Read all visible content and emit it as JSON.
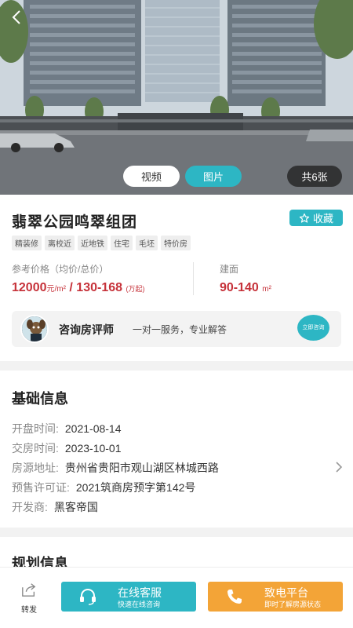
{
  "hero": {
    "tabs": [
      {
        "label": "视频",
        "active": false
      },
      {
        "label": "图片",
        "active": true
      }
    ],
    "photo_count": "共6张"
  },
  "project": {
    "title": "翡翠公园鸣翠组团",
    "favorite_label": "收藏",
    "tags": [
      "精装修",
      "离校近",
      "近地铁",
      "住宅",
      "毛坯",
      "特价房"
    ],
    "price_label": "参考价格（均价/总价）",
    "avg_price": "12000",
    "avg_price_unit": "元/m²",
    "price_sep": " / ",
    "total_price": "130-168",
    "total_price_unit": "(万起)",
    "area_label": "建面",
    "area_value": "90-140",
    "area_unit": "m²"
  },
  "consult": {
    "name": "咨询房评师",
    "desc": "一对一服务，专业解答",
    "button": "立即咨询"
  },
  "basic_info": {
    "title": "基础信息",
    "rows": [
      {
        "label": "开盘时间:",
        "value": "2021-08-14"
      },
      {
        "label": "交房时间:",
        "value": "2023-10-01"
      },
      {
        "label": "房源地址:",
        "value": "贵州省贵阳市观山湖区林城西路"
      },
      {
        "label": "预售许可证:",
        "value": "2021筑商房预字第142号"
      },
      {
        "label": "开发商:",
        "value": "黑客帝国"
      }
    ]
  },
  "planning": {
    "title": "规划信息"
  },
  "bottom_bar": {
    "share_label": "转发",
    "service_main": "在线客服",
    "service_sub": "快速在线咨询",
    "call_main": "致电平台",
    "call_sub": "即时了解房源状态"
  },
  "colors": {
    "accent": "#2db6c4",
    "price": "#c6323a",
    "call": "#f3a437"
  },
  "icons": [
    "back-arrow-icon",
    "star-icon",
    "chevron-right-icon",
    "share-icon",
    "headset-icon",
    "phone-icon"
  ]
}
